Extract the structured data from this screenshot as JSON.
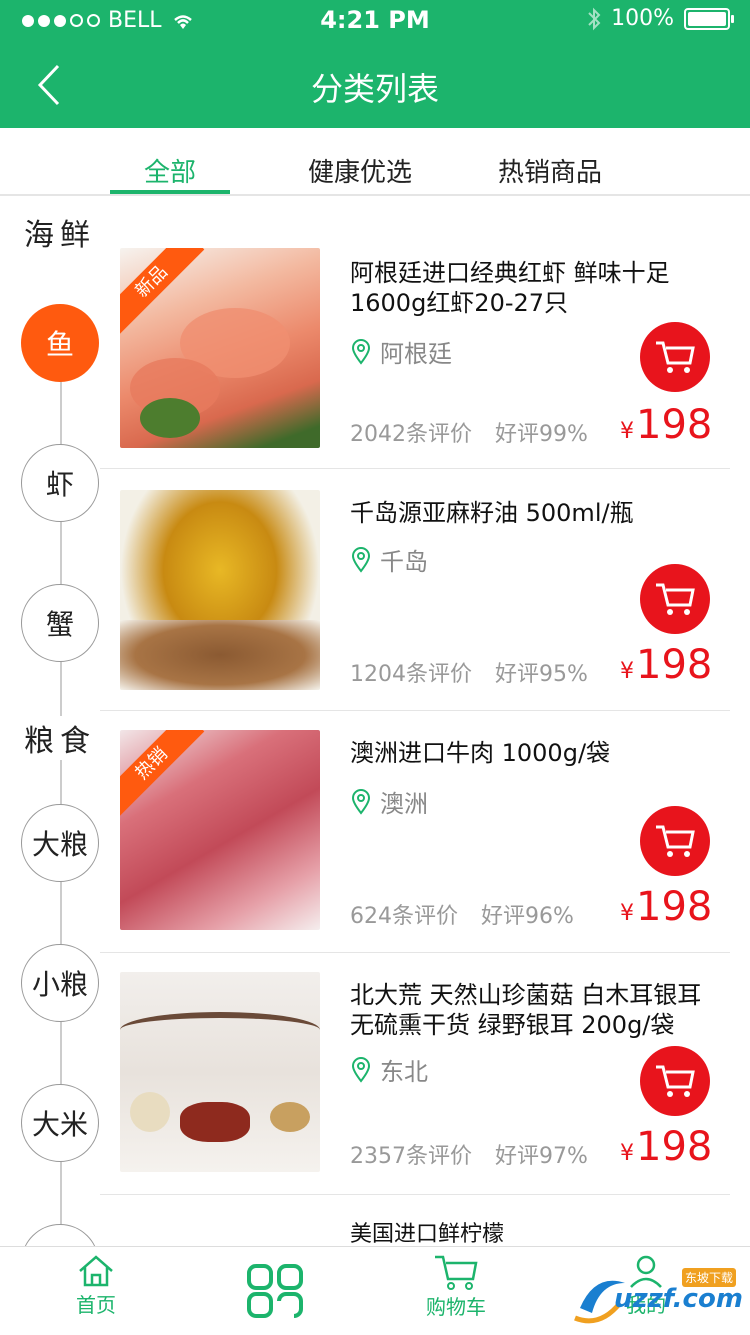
{
  "status": {
    "carrier": "BELL",
    "time": "4:21 PM",
    "battery": "100%"
  },
  "header": {
    "title": "分类列表"
  },
  "tabs": [
    {
      "label": "全部"
    },
    {
      "label": "健康优选"
    },
    {
      "label": "热销商品"
    }
  ],
  "sidebar": {
    "group1": "海鲜",
    "group1_items": [
      "鱼",
      "虾",
      "蟹"
    ],
    "group2": "粮食",
    "group2_items": [
      "大粮",
      "小粮",
      "大米"
    ]
  },
  "products": [
    {
      "name": "阿根廷进口经典红虾  鲜味十足 1600g红虾20-27只",
      "origin": "阿根廷",
      "reviews": "2042条评价",
      "positive": "好评99%",
      "currency": "¥",
      "price": "198",
      "badge": "新品"
    },
    {
      "name": "千岛源亚麻籽油  500ml/瓶",
      "origin": "千岛",
      "reviews": "1204条评价",
      "positive": "好评95%",
      "currency": "¥",
      "price": "198",
      "badge": ""
    },
    {
      "name": "澳洲进口牛肉  1000g/袋",
      "origin": "澳洲",
      "reviews": "624条评价",
      "positive": "好评96%",
      "currency": "¥",
      "price": "198",
      "badge": "热销"
    },
    {
      "name": "北大荒 天然山珍菌菇 白木耳银耳 无硫熏干货 绿野银耳   200g/袋",
      "origin": "东北",
      "reviews": "2357条评价",
      "positive": "好评97%",
      "currency": "¥",
      "price": "198",
      "badge": ""
    },
    {
      "name": "美国进口鲜柠檬"
    }
  ],
  "bottom_nav": [
    {
      "label": "首页"
    },
    {
      "label": ""
    },
    {
      "label": "购物车"
    },
    {
      "label": "我的"
    }
  ],
  "watermark": {
    "text": "uzzf.com",
    "tag": "东坡下载"
  },
  "colors": {
    "primary": "#1cb46c",
    "accent": "#ff5a0f",
    "price": "#e8141c"
  }
}
